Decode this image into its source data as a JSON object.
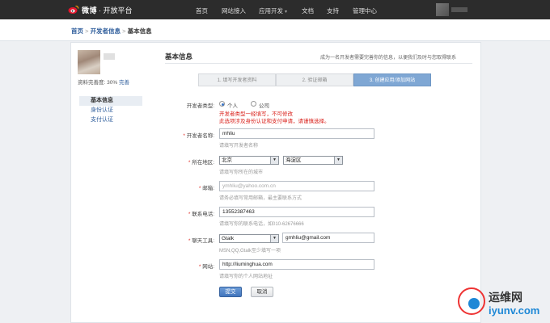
{
  "brand": {
    "name": "微博",
    "subtitle": "· 开放平台"
  },
  "nav": [
    {
      "label": "首页"
    },
    {
      "label": "网站接入"
    },
    {
      "label": "应用开发",
      "caret": "▾"
    },
    {
      "label": "文档"
    },
    {
      "label": "支持"
    },
    {
      "label": "管理中心"
    }
  ],
  "breadcrumb": {
    "home": "首页",
    "sep": " > ",
    "dev": "开发者信息",
    "current": "基本信息"
  },
  "sidebar": {
    "completeness_label": "资料完善度: 30%",
    "completeness_link": "完善",
    "items": [
      "基本信息",
      "身份认证",
      "支付认证"
    ]
  },
  "section": {
    "title": "基本信息",
    "desc": "成为一名开发者需要完善你的信息，以便我们及时与您取得联系"
  },
  "steps": [
    "1. 填写开发者资料",
    "2. 验证邮箱",
    "3. 创建应用/添加网站"
  ],
  "form": {
    "dev_type": {
      "label": "开发者类型:",
      "option_personal": "个人",
      "option_company": "公司",
      "warning_1": "开发者类型一经填写，不可修改",
      "warning_2": "此选项涉及身份认证和支付申请，请谨慎选择。"
    },
    "name": {
      "label": "开发者名称:",
      "value": "mhliu",
      "hint": "请填写开发者名称"
    },
    "region": {
      "label": "所在地区:",
      "province": "北京",
      "district": "海淀区",
      "hint": "请填写你所在的城市"
    },
    "email": {
      "label": "邮箱:",
      "placeholder": "ymhliu@yahoo.com.cn",
      "hint": "请务必填写常用邮箱，最主要联系方式"
    },
    "phone": {
      "label": "联系电话:",
      "value": "13552387463",
      "hint": "请填写你的联系电话，如010-62676666"
    },
    "chat": {
      "label": "聊天工具:",
      "tool": "Gtalk",
      "value": "gmhliu@gmail.com",
      "hint": "MSN,QQ,Gtalk至少填写一项"
    },
    "website": {
      "label": "网站:",
      "value": "http://liuminghua.com",
      "hint": "请填写你的个人网站地址"
    },
    "submit": "提交",
    "cancel": "取消"
  },
  "watermark": {
    "cn": "运维网",
    "en": "iyunv.com"
  },
  "colors": {
    "accent": "#2f5e9c",
    "warning": "#d91d17",
    "topbar": "#2c2c2c",
    "step_active": "#7fa7d4"
  }
}
